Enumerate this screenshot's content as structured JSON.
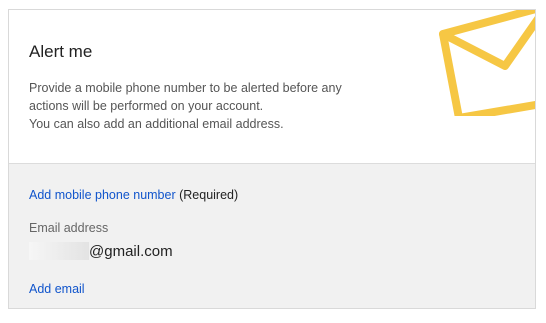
{
  "card": {
    "title": "Alert me",
    "description_lines": [
      "Provide a mobile phone number to be alerted before any",
      "actions will be performed on your account.",
      "You can also add an additional email address."
    ],
    "envelope_icon": "envelope-icon",
    "accent_color": "#f6c744"
  },
  "phone": {
    "add_link": "Add mobile phone number",
    "required_note": "(Required)"
  },
  "email": {
    "label": "Email address",
    "value_suffix": "@gmail.com",
    "add_link": "Add email"
  },
  "colors": {
    "link": "#1155cc",
    "panel_bg": "#f1f1f1"
  }
}
